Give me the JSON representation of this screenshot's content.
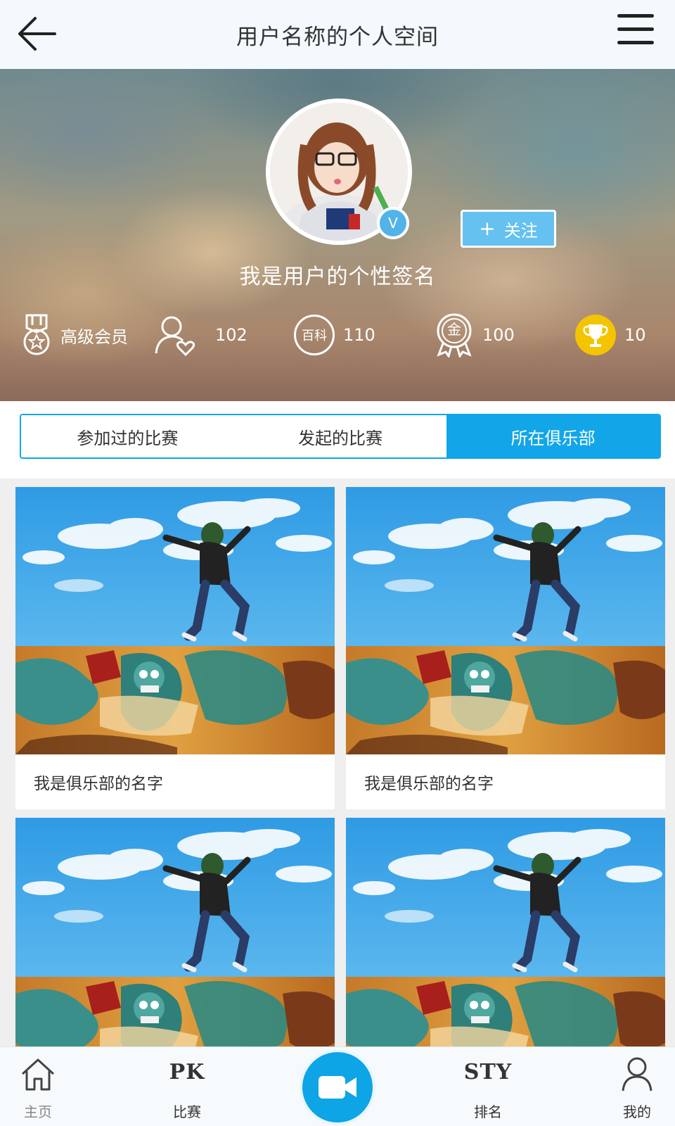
{
  "header": {
    "title": "用户名称的个人空间"
  },
  "profile": {
    "verified_badge": "V",
    "follow_label": "关注",
    "follow_plus": "+",
    "signature": "我是用户的个性签名"
  },
  "stats": [
    {
      "icon": "member-medal-icon",
      "value": "高级会员"
    },
    {
      "icon": "followers-heart-icon",
      "value": "102"
    },
    {
      "icon": "baike-icon",
      "icon_text": "百科",
      "value": "110"
    },
    {
      "icon": "gold-medal-icon",
      "icon_text": "金",
      "value": "100"
    },
    {
      "icon": "trophy-icon",
      "value": "10"
    }
  ],
  "tabs": [
    {
      "label": "参加过的比赛",
      "active": false
    },
    {
      "label": "发起的比赛",
      "active": false
    },
    {
      "label": "所在俱乐部",
      "active": true
    }
  ],
  "clubs": [
    {
      "name": "我是俱乐部的名字"
    },
    {
      "name": "我是俱乐部的名字"
    },
    {
      "name": ""
    },
    {
      "name": ""
    }
  ],
  "bottom_nav": {
    "home_label": "主页",
    "match_badge": "PK",
    "match_label": "比赛",
    "rank_badge": "STY",
    "rank_label": "排名",
    "mine_label": "我的"
  },
  "colors": {
    "accent": "#12a6e8",
    "follow_button": "#65c1ef",
    "trophy": "#f5c400"
  }
}
